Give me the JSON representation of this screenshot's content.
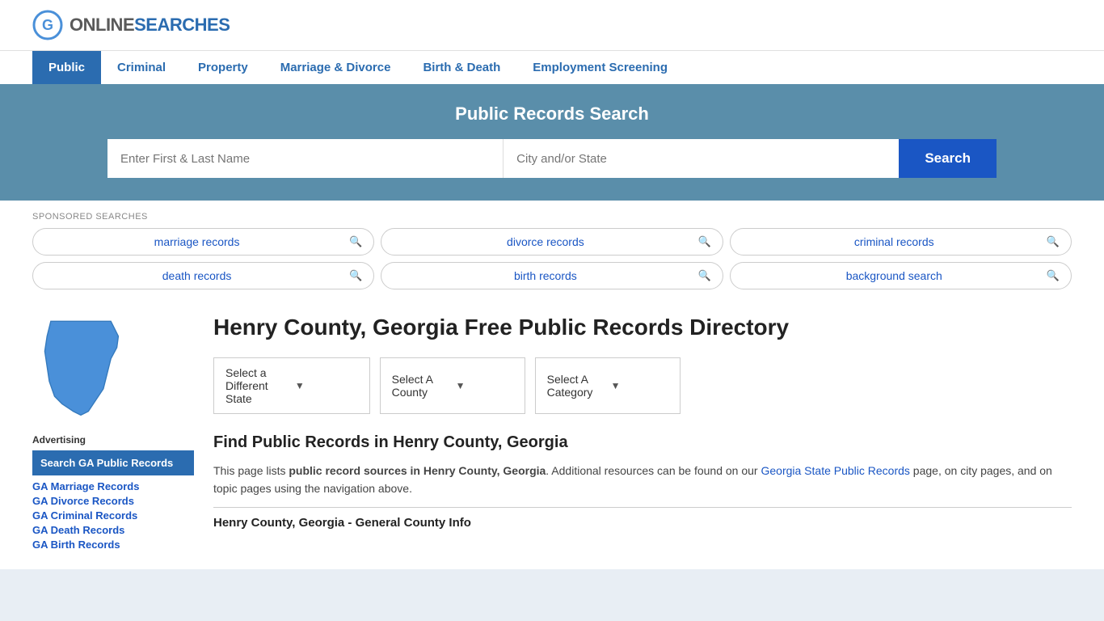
{
  "header": {
    "logo_text_online": "ONLINE",
    "logo_text_searches": "SEARCHES"
  },
  "nav": {
    "items": [
      {
        "label": "Public",
        "active": true
      },
      {
        "label": "Criminal",
        "active": false
      },
      {
        "label": "Property",
        "active": false
      },
      {
        "label": "Marriage & Divorce",
        "active": false
      },
      {
        "label": "Birth & Death",
        "active": false
      },
      {
        "label": "Employment Screening",
        "active": false
      }
    ]
  },
  "hero": {
    "title": "Public Records Search",
    "name_placeholder": "Enter First & Last Name",
    "location_placeholder": "City and/or State",
    "search_button": "Search"
  },
  "sponsored": {
    "label": "SPONSORED SEARCHES",
    "pills": [
      {
        "text": "marriage records"
      },
      {
        "text": "divorce records"
      },
      {
        "text": "criminal records"
      },
      {
        "text": "death records"
      },
      {
        "text": "birth records"
      },
      {
        "text": "background search"
      }
    ]
  },
  "sidebar": {
    "ad_label": "Advertising",
    "featured_link": "Search GA Public Records",
    "links": [
      {
        "text": "GA Marriage Records"
      },
      {
        "text": "GA Divorce Records"
      },
      {
        "text": "GA Criminal Records"
      },
      {
        "text": "GA Death Records"
      },
      {
        "text": "GA Birth Records"
      }
    ]
  },
  "main": {
    "page_title": "Henry County, Georgia Free Public Records Directory",
    "dropdowns": {
      "state": "Select a Different State",
      "county": "Select A County",
      "category": "Select A Category"
    },
    "find_title": "Find Public Records in Henry County, Georgia",
    "find_desc_part1": "This page lists ",
    "find_desc_bold": "public record sources in Henry County, Georgia",
    "find_desc_part2": ". Additional resources can be found on our ",
    "find_desc_link": "Georgia State Public Records",
    "find_desc_part3": " page, on city pages, and on topic pages using the navigation above.",
    "county_info_heading": "Henry County, Georgia - General County Info"
  }
}
